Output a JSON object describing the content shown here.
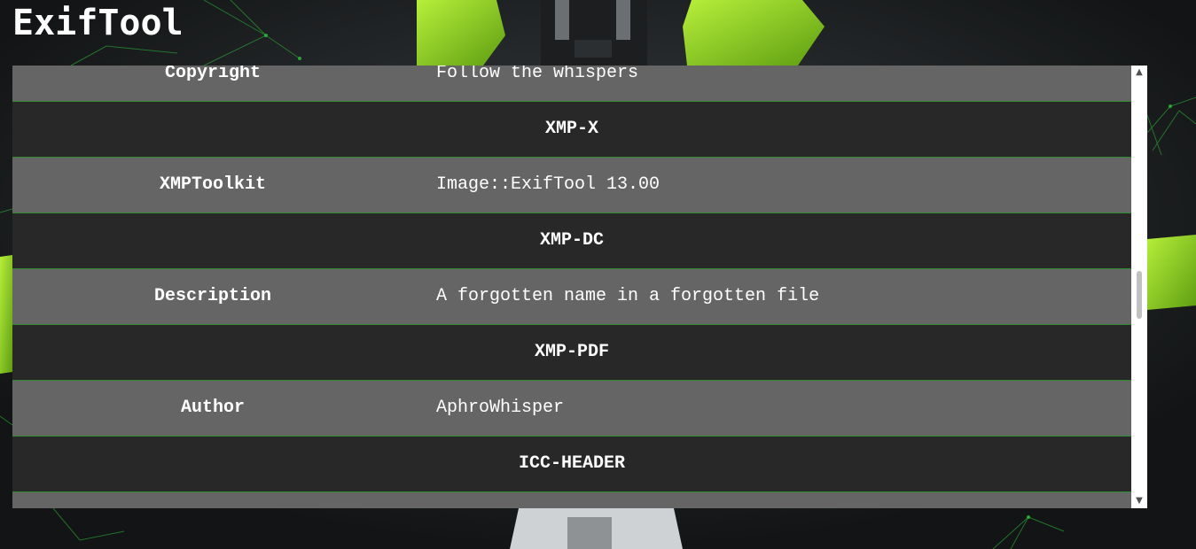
{
  "app": {
    "title": "ExifTool"
  },
  "table": {
    "rows": [
      {
        "kind": "tag",
        "tag": "Copyright",
        "value": "Follow the whispers"
      },
      {
        "kind": "group",
        "group": "XMP-X"
      },
      {
        "kind": "tag",
        "tag": "XMPToolkit",
        "value": "Image::ExifTool 13.00"
      },
      {
        "kind": "group",
        "group": "XMP-DC"
      },
      {
        "kind": "tag",
        "tag": "Description",
        "value": "A forgotten name in a forgotten file"
      },
      {
        "kind": "group",
        "group": "XMP-PDF"
      },
      {
        "kind": "tag",
        "tag": "Author",
        "value": "AphroWhisper"
      },
      {
        "kind": "group",
        "group": "ICC-HEADER"
      }
    ]
  },
  "scrollbar": {
    "up_arrow": "▲",
    "down_arrow": "▼",
    "up_icon": "chevron-up-icon",
    "down_icon": "chevron-down-icon"
  },
  "colors": {
    "tag_row_bg": "#656565",
    "group_row_bg": "#282828",
    "row_border": "#2f8a2f",
    "text": "#ffffff",
    "accent_green": "#8fd11f"
  }
}
